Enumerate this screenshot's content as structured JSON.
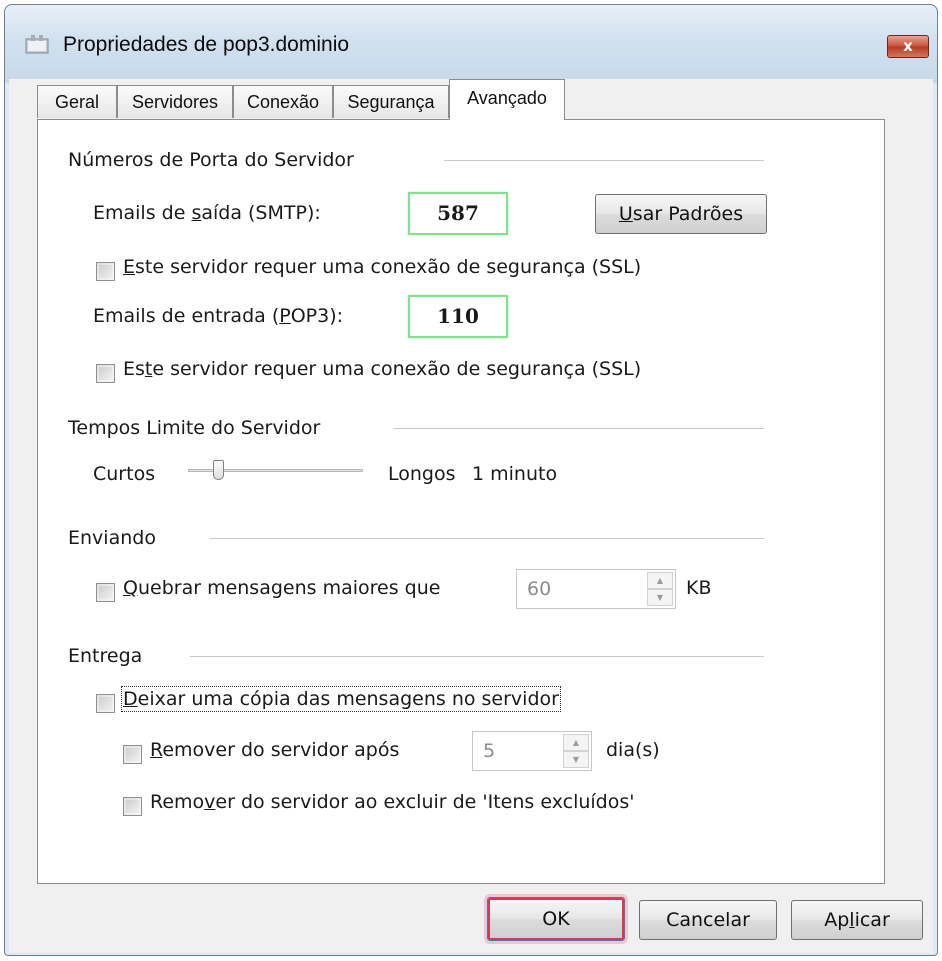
{
  "window": {
    "title": "Propriedades de pop3.dominio",
    "close_glyph": "x"
  },
  "tabs": [
    {
      "label": "Geral"
    },
    {
      "label": "Servidores"
    },
    {
      "label": "Conexão"
    },
    {
      "label": "Segurança"
    },
    {
      "label": "Avançado",
      "active": true
    }
  ],
  "ports": {
    "section_title": "Números de Porta do Servidor",
    "smtp_label_pre": "Emails de ",
    "smtp_label_u": "s",
    "smtp_label_post": "aída (SMTP):",
    "smtp_value": "587",
    "defaults_button_u": "U",
    "defaults_button_rest": "sar Padrões",
    "ssl1_u": "E",
    "ssl1_rest": "ste servidor requer uma conexão de segurança (SSL)",
    "pop3_label_pre": "Emails de entrada (",
    "pop3_label_u": "P",
    "pop3_label_post": "OP3):",
    "pop3_value": "110",
    "ssl2_pre": "Es",
    "ssl2_u": "t",
    "ssl2_rest": "e servidor requer uma conexão de segurança (SSL)"
  },
  "timeouts": {
    "section_title": "Tempos Limite do Servidor",
    "short_label": "Curtos",
    "long_label": "Longos",
    "value_text": "1 minuto",
    "slider_level": 0.15
  },
  "sending": {
    "section_title": "Enviando",
    "break_u": "Q",
    "break_rest": "uebrar mensagens maiores que",
    "size_value": "60",
    "size_unit": "KB"
  },
  "delivery": {
    "section_title": "Entrega",
    "leave_copy_u": "D",
    "leave_copy_rest": "eixar uma cópia das mensagens no servidor",
    "remove_after_u": "R",
    "remove_after_rest": "emover do servidor após",
    "days_value": "5",
    "days_unit": "dia(s)",
    "remove_deleted_pre": "Remo",
    "remove_deleted_u": "v",
    "remove_deleted_rest": "er do servidor ao excluir de 'Itens excluídos'"
  },
  "footer": {
    "ok": "OK",
    "cancel": "Cancelar",
    "apply_pre": "Ap",
    "apply_u": "l",
    "apply_rest": "icar"
  },
  "spin_up": "▲",
  "spin_down": "▼"
}
